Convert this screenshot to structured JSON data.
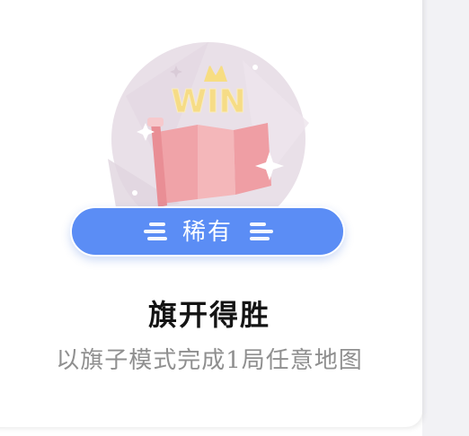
{
  "achievement": {
    "badge_text": "WIN",
    "rarity_label": "稀有",
    "title": "旗开得胜",
    "description": "以旗子模式完成1局任意地图"
  },
  "icons": {
    "badge": "flag-win-badge-icon",
    "crown": "crown-icon",
    "sparkle": "sparkle-icon"
  },
  "colors": {
    "rarity_pill": "#5b8df5",
    "title": "#141414",
    "description": "#8f8f8f",
    "badge_circle": "#e8dfe6",
    "flag": "#f2a9ad",
    "win_text": "#f6dc86"
  }
}
